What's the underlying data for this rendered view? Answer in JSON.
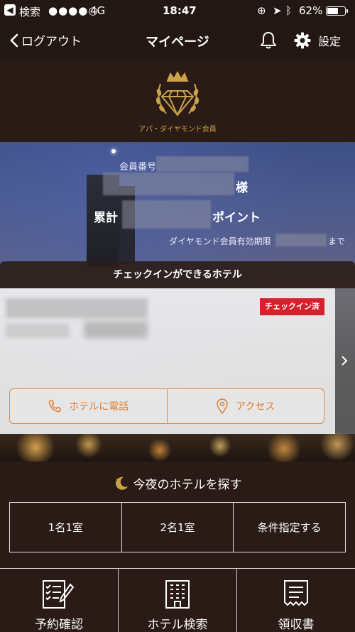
{
  "status_bar": {
    "back_app": "検索",
    "carrier": "4G",
    "time": "18:47",
    "battery": "62%",
    "battery_level": 0.62
  },
  "nav": {
    "back_label": "ログアウト",
    "title": "マイページ",
    "settings_label": "設定"
  },
  "brand": {
    "logo_text": "アパ・ダイヤモンド会員",
    "gold": "#c9a24a"
  },
  "member": {
    "number_label": "会員番号",
    "honorific": "様",
    "total_label": "累計",
    "points_label": "ポイント",
    "expiry_label": "ダイヤモンド会員有効期限",
    "expiry_suffix": "まで"
  },
  "checkin": {
    "header": "チェックインができるホテル",
    "badge": "チェックイン済",
    "call_label": "ホテルに電話",
    "access_label": "アクセス",
    "accent": "#e07d2e",
    "badge_color": "#d8202c"
  },
  "tonight": {
    "title": "今夜のホテルを探す",
    "options": [
      "1名1室",
      "2名1室",
      "条件指定する"
    ]
  },
  "bottom_nav": {
    "items": [
      "予約確認",
      "ホテル検索",
      "領収書"
    ]
  }
}
